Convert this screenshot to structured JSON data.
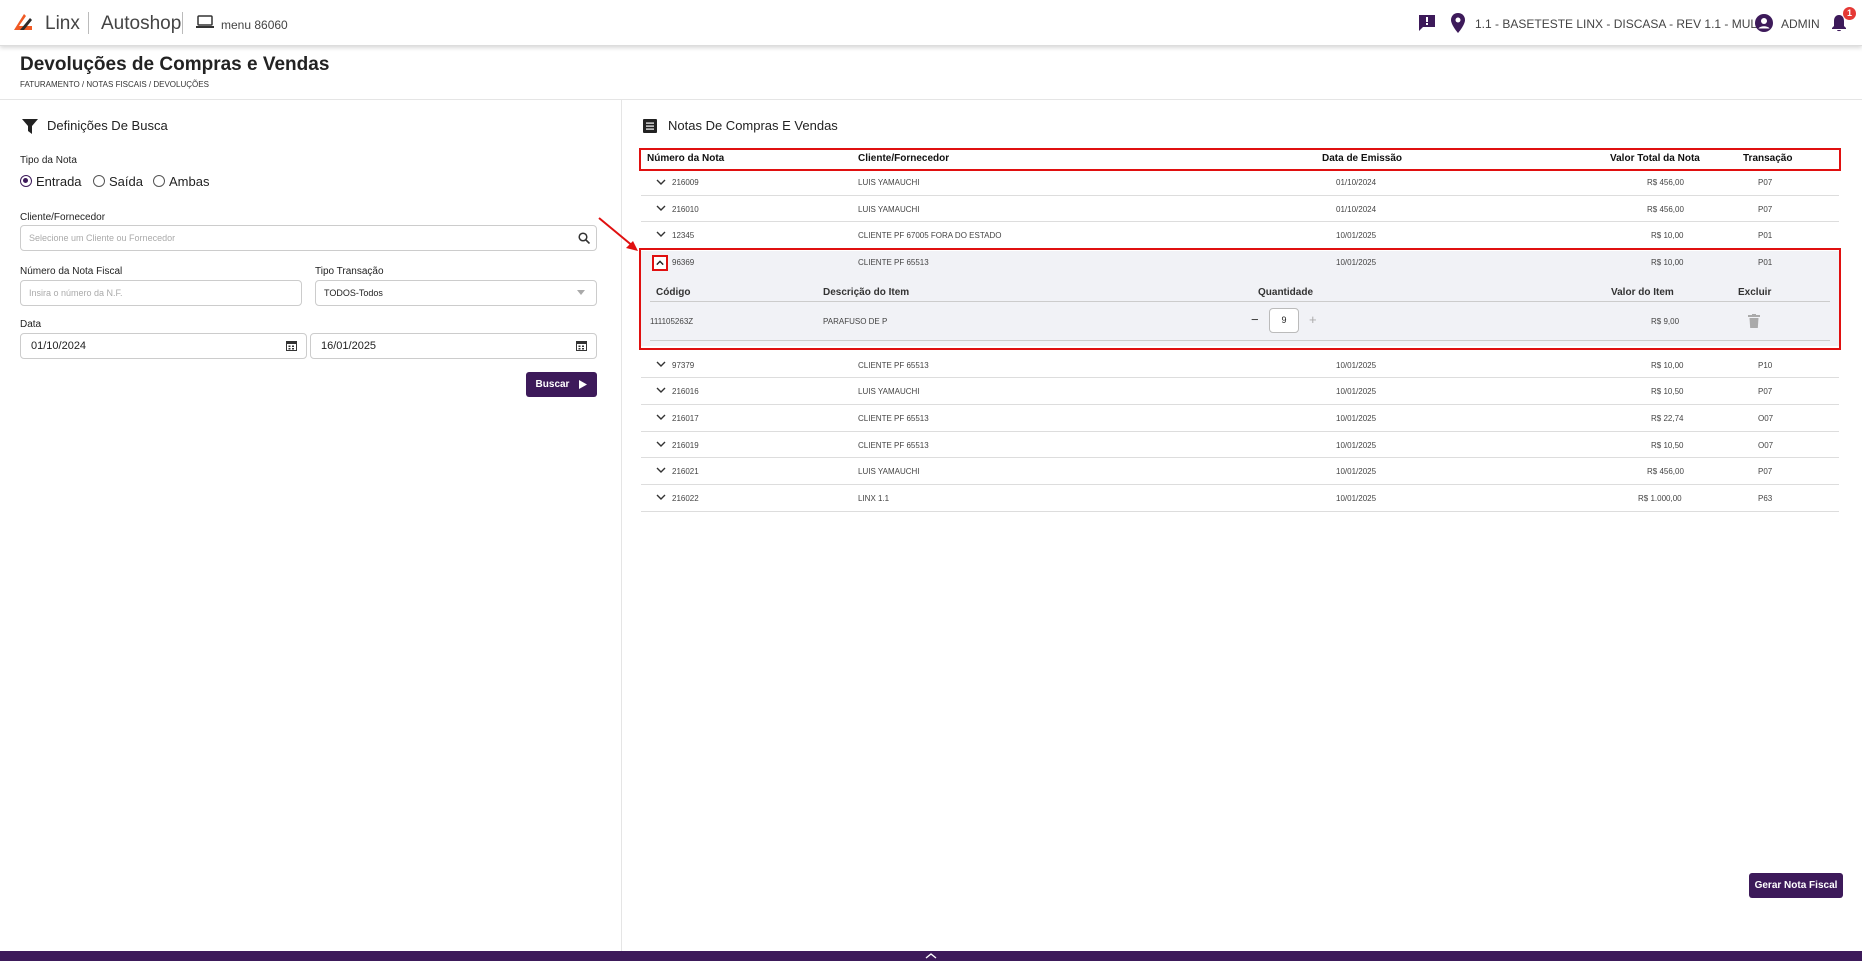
{
  "header": {
    "brand": "Linx",
    "product": "Autoshop",
    "menu_label": "menu 86060",
    "location": "1.1 - BASETESTE LINX - DISCASA - REV 1.1 - MULT",
    "user": "ADMIN",
    "notification_count": "1",
    "accent": "#3d1a5a",
    "logo_color": "#f05a24"
  },
  "page": {
    "title": "Devoluções de Compras e Vendas",
    "breadcrumb": "FATURAMENTO / NOTAS FISCAIS / DEVOLUÇÕES"
  },
  "search": {
    "title": "Definições De Busca",
    "tipo_label": "Tipo da Nota",
    "options": [
      "Entrada",
      "Saída",
      "Ambas"
    ],
    "selected": "Entrada",
    "cliente_label": "Cliente/Fornecedor",
    "cliente_placeholder": "Selecione um Cliente ou Fornecedor",
    "nota_label": "Número da Nota Fiscal",
    "nota_placeholder": "Insira o número da N.F.",
    "transacao_label": "Tipo Transação",
    "transacao_value": "TODOS-Todos",
    "data_label": "Data",
    "date_from": "01/10/2024",
    "date_to": "16/01/2025",
    "buscar_label": "Buscar"
  },
  "notes": {
    "title": "Notas De Compras E Vendas",
    "columns": [
      "Número da Nota",
      "Cliente/Fornecedor",
      "Data de Emissão",
      "Valor Total da Nota",
      "Transação"
    ],
    "rows": [
      {
        "numero": "216009",
        "cliente": "LUIS YAMAUCHI",
        "data": "01/10/2024",
        "valor": "R$ 456,00",
        "transacao": "P07"
      },
      {
        "numero": "216010",
        "cliente": "LUIS YAMAUCHI",
        "data": "01/10/2024",
        "valor": "R$ 456,00",
        "transacao": "P07"
      },
      {
        "numero": "12345",
        "cliente": "CLIENTE PF 67005 FORA DO ESTADO",
        "data": "10/01/2025",
        "valor": "R$ 10,00",
        "transacao": "P01"
      },
      {
        "numero": "96369",
        "cliente": "CLIENTE PF 65513",
        "data": "10/01/2025",
        "valor": "R$ 10,00",
        "transacao": "P01"
      },
      {
        "numero": "97379",
        "cliente": "CLIENTE PF 65513",
        "data": "10/01/2025",
        "valor": "R$ 10,00",
        "transacao": "P10"
      },
      {
        "numero": "216016",
        "cliente": "LUIS YAMAUCHI",
        "data": "10/01/2025",
        "valor": "R$ 10,50",
        "transacao": "P07"
      },
      {
        "numero": "216017",
        "cliente": "CLIENTE PF 65513",
        "data": "10/01/2025",
        "valor": "R$ 22,74",
        "transacao": "O07"
      },
      {
        "numero": "216019",
        "cliente": "CLIENTE PF 65513",
        "data": "10/01/2025",
        "valor": "R$ 10,50",
        "transacao": "O07"
      },
      {
        "numero": "216021",
        "cliente": "LUIS YAMAUCHI",
        "data": "10/01/2025",
        "valor": "R$ 456,00",
        "transacao": "P07"
      },
      {
        "numero": "216022",
        "cliente": "LINX 1.1",
        "data": "10/01/2025",
        "valor": "R$ 1.000,00",
        "transacao": "P63"
      }
    ],
    "item_columns": [
      "Código",
      "Descrição do Item",
      "Quantidade",
      "Valor do Item",
      "Excluir"
    ],
    "item": {
      "codigo": "111105263Z",
      "descricao": "PARAFUSO DE P",
      "quantidade": "9",
      "valor": "R$ 9,00"
    },
    "gerar_label": "Gerar Nota Fiscal"
  }
}
